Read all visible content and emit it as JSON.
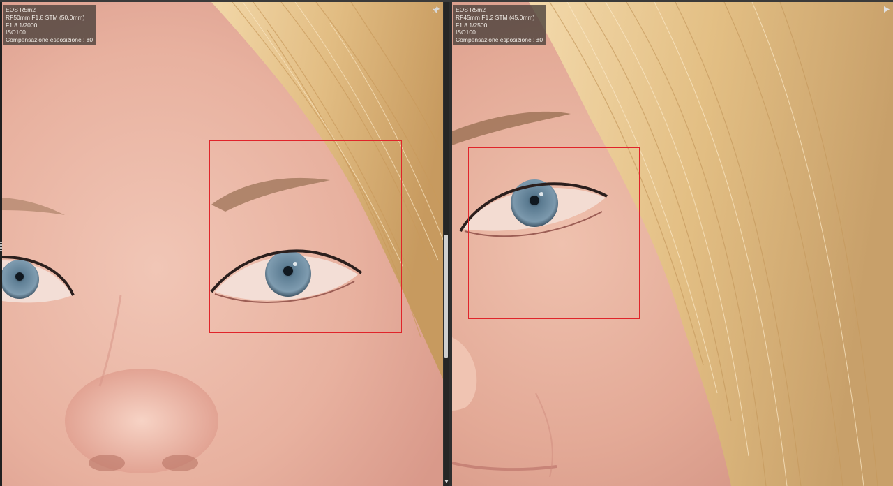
{
  "left_pane": {
    "exif": {
      "camera": "EOS R5m2",
      "lens": "RF50mm F1.8 STM (50.0mm)",
      "exposure": "F1.8 1/2000",
      "iso": "ISO100",
      "compensation": "Compensazione esposizione : ±0"
    },
    "corner_icon": "pin-icon"
  },
  "right_pane": {
    "exif": {
      "camera": "EOS R5m2",
      "lens": "RF45mm F1.2 STM (45.0mm)",
      "exposure": "F1.8 1/2500",
      "iso": "ISO100",
      "compensation": "Compensazione esposizione : ±0"
    },
    "corner_icon": "play-icon"
  },
  "colors": {
    "focus_frame": "#e0242a",
    "skin": "#e9b4a3",
    "hair": "#e6c488",
    "iris": "#6f8ea3"
  },
  "scrollbar": {
    "icon": "chevron-down-icon"
  }
}
